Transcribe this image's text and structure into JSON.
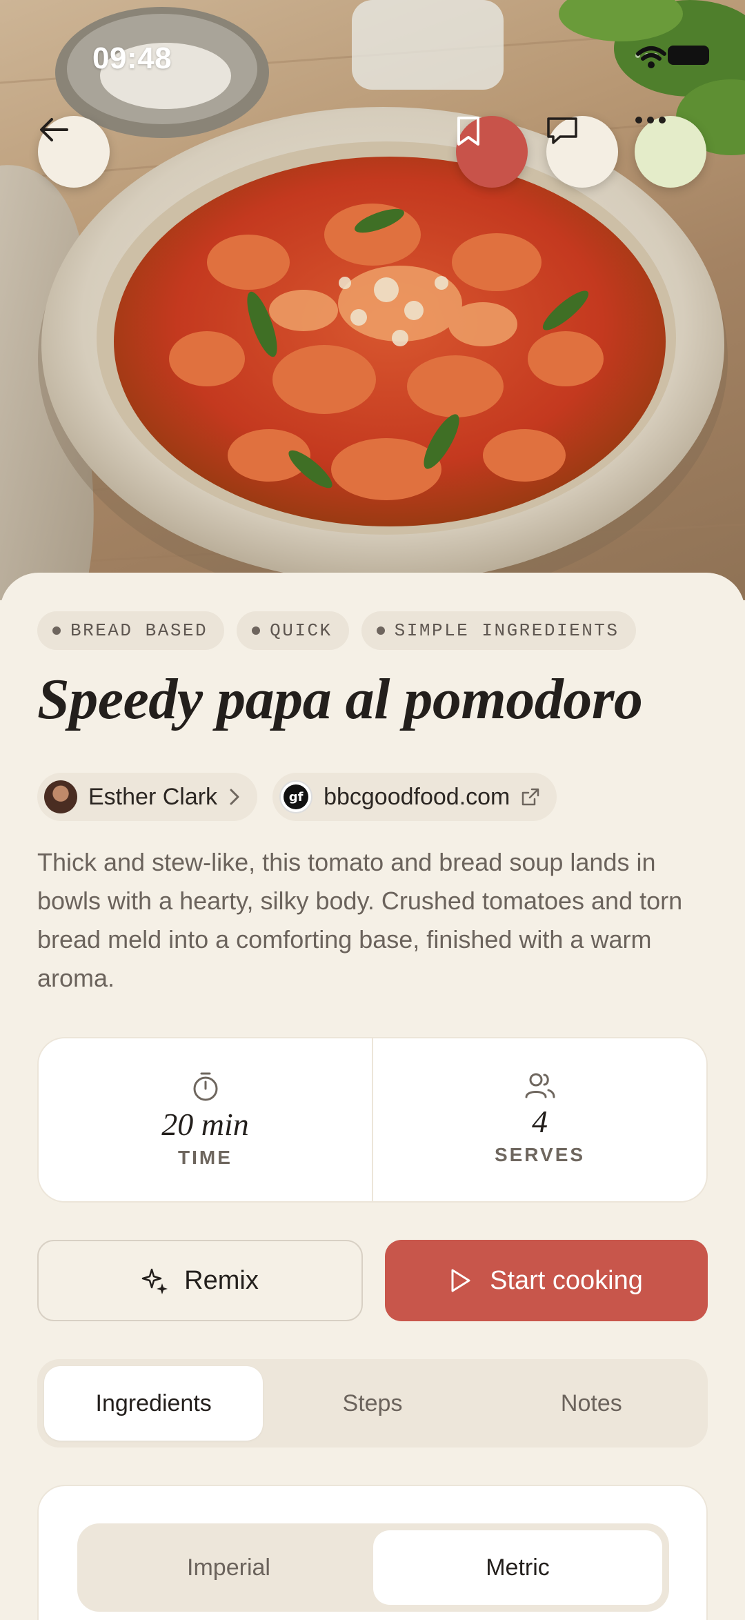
{
  "status_bar": {
    "time": "09:48"
  },
  "header": {
    "back_icon": "arrow-left-icon",
    "bookmark_icon": "bookmark-icon",
    "comment_icon": "comment-icon",
    "more_icon": "more-icon",
    "bookmark_color": "#c8534a"
  },
  "recipe": {
    "tags": [
      "BREAD BASED",
      "QUICK",
      "SIMPLE INGREDIENTS"
    ],
    "title": "Speedy papa al pomodoro",
    "author": "Esther Clark",
    "source": "bbcgoodfood.com",
    "source_logo_text": "gf",
    "description": "Thick and stew-like, this tomato and bread soup lands in bowls with a hearty, silky body. Crushed tomatoes and torn bread meld into a comforting base, finished with a warm aroma."
  },
  "stats": {
    "time_value": "20 min",
    "time_label": "TIME",
    "serves_value": "4",
    "serves_label": "SERVES"
  },
  "actions": {
    "remix_label": "Remix",
    "start_label": "Start cooking",
    "start_color": "#c8564b"
  },
  "tabs": [
    {
      "label": "Ingredients",
      "active": true
    },
    {
      "label": "Steps",
      "active": false
    },
    {
      "label": "Notes",
      "active": false
    }
  ],
  "units": [
    {
      "label": "Imperial",
      "active": false
    },
    {
      "label": "Metric",
      "active": true
    }
  ]
}
